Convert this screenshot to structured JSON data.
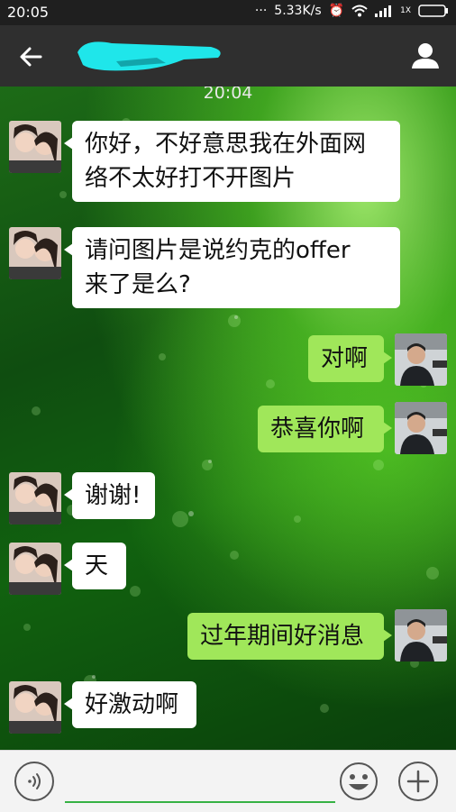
{
  "status_bar": {
    "time": "20:05",
    "network_speed": "5.33K/s",
    "signal_label": "1X"
  },
  "header": {
    "contact_name_redacted": true
  },
  "chat": {
    "timestamp": "20:04",
    "messages": [
      {
        "side": "in",
        "text_lines": [
          "你好，不好意思我在外面网",
          "络不太好打不开图片"
        ]
      },
      {
        "side": "in",
        "text_lines": [
          "请问图片是说约克的offer",
          "来了是么?"
        ]
      },
      {
        "side": "out",
        "text_lines": [
          "对啊"
        ]
      },
      {
        "side": "out",
        "text_lines": [
          "恭喜你啊"
        ]
      },
      {
        "side": "in",
        "text_lines": [
          "谢谢!"
        ]
      },
      {
        "side": "in",
        "text_lines": [
          "天"
        ]
      },
      {
        "side": "out",
        "text_lines": [
          "过年期间好消息"
        ]
      },
      {
        "side": "in",
        "text_lines": [
          "好激动啊"
        ]
      }
    ]
  },
  "input_bar": {
    "placeholder": ""
  },
  "colors": {
    "incoming_bubble": "#ffffff",
    "outgoing_bubble": "#a0e75a",
    "input_underline": "#36b244"
  }
}
